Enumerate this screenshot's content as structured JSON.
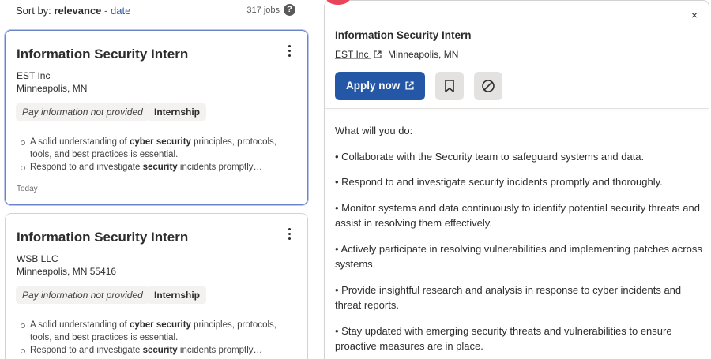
{
  "sort": {
    "label": "Sort by:",
    "active": "relevance",
    "separator": "-",
    "alternate": "date",
    "count": "317 jobs",
    "help": "?"
  },
  "cards": [
    {
      "title": "Information Security Intern",
      "company": "EST Inc",
      "location": "Minneapolis, MN",
      "pay": "Pay information not provided",
      "type": "Internship",
      "snippet": [
        {
          "pre": "A solid understanding of ",
          "bold": "cyber security",
          "post": " principles, protocols,"
        },
        {
          "pre": "tools, and best practices is essential.",
          "bold": "",
          "post": ""
        },
        {
          "pre": "Respond to and investigate ",
          "bold": "security",
          "post": " incidents promptly…"
        }
      ],
      "posted": "Today",
      "selected": true
    },
    {
      "title": "Information Security Intern",
      "company": "WSB LLC",
      "location": "Minneapolis, MN 55416",
      "pay": "Pay information not provided",
      "type": "Internship",
      "snippet": [
        {
          "pre": "A solid understanding of ",
          "bold": "cyber security",
          "post": " principles, protocols,"
        },
        {
          "pre": "tools, and best practices is essential.",
          "bold": "",
          "post": ""
        },
        {
          "pre": "Respond to and investigate ",
          "bold": "security",
          "post": " incidents promptly…"
        }
      ],
      "selected": false
    }
  ],
  "detail": {
    "title": "Information Security Intern",
    "company": "EST Inc",
    "location": "Minneapolis, MN",
    "apply_label": "Apply now",
    "close_icon": "×",
    "description": [
      "What will you do:",
      "• Collaborate with the Security team to safeguard systems and data.",
      "• Respond to and investigate security incidents promptly and thoroughly.",
      "• Monitor systems and data continuously to identify potential security threats and assist in resolving them effectively.",
      "• Actively participate in resolving vulnerabilities and implementing patches across systems.",
      "• Provide insightful research and analysis in response to cyber incidents and threat reports.",
      "• Stay updated with emerging security threats and vulnerabilities to ensure proactive measures are in place."
    ]
  },
  "icons": {
    "help": "help-icon",
    "kebab": "more-options-icon",
    "external": "external-link-icon",
    "bookmark": "bookmark-icon",
    "hide": "not-interested-icon",
    "close": "close-icon"
  },
  "colors": {
    "brand": "#2557a7",
    "selected_border": "#6b84c9",
    "tag_bg": "#f3f2f1",
    "icon_button_bg": "#e4e2e0"
  }
}
